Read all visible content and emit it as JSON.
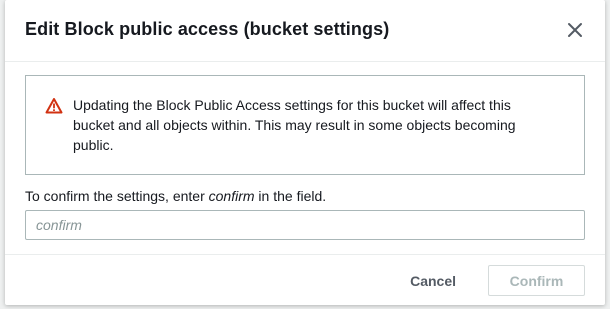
{
  "modal": {
    "title": "Edit Block public access (bucket settings)",
    "close_icon": "close-icon"
  },
  "alert": {
    "icon": "warning-icon",
    "icon_color": "#d13212",
    "message": "Updating the Block Public Access settings for this bucket will affect this bucket and all objects within. This may result in some objects becoming public."
  },
  "confirmation": {
    "label_prefix": "To confirm the settings, enter ",
    "label_keyword": "confirm",
    "label_suffix": " in the field.",
    "input_value": "",
    "input_placeholder": "confirm"
  },
  "footer": {
    "cancel_label": "Cancel",
    "confirm_label": "Confirm",
    "confirm_disabled": true
  }
}
